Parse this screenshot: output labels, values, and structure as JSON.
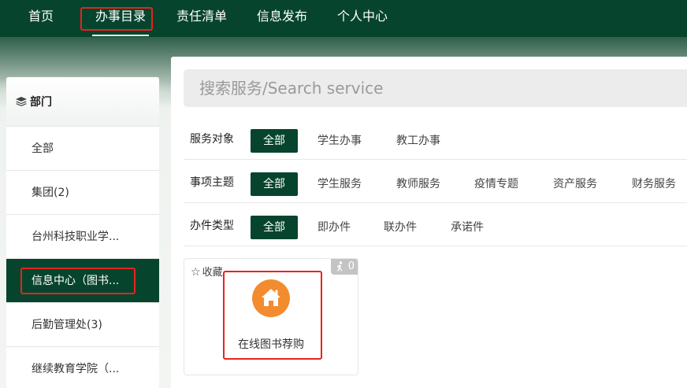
{
  "nav": {
    "items": [
      {
        "label": "首页"
      },
      {
        "label": "办事目录"
      },
      {
        "label": "责任清单"
      },
      {
        "label": "信息发布"
      },
      {
        "label": "个人中心"
      }
    ]
  },
  "sidebar": {
    "title": "部门",
    "items": [
      {
        "label": "全部"
      },
      {
        "label": "集团(2)"
      },
      {
        "label": "台州科技职业学..."
      },
      {
        "label": "信息中心（图书..."
      },
      {
        "label": "后勤管理处(3)"
      },
      {
        "label": "继续教育学院（..."
      }
    ]
  },
  "search": {
    "placeholder": "搜索服务/Search service"
  },
  "filters": {
    "target": {
      "label": "服务对象",
      "options": [
        "全部",
        "学生办事",
        "教工办事"
      ]
    },
    "topic": {
      "label": "事项主题",
      "options": [
        "全部",
        "学生服务",
        "教师服务",
        "疫情专题",
        "资产服务",
        "财务服务"
      ]
    },
    "type": {
      "label": "办件类型",
      "options": [
        "全部",
        "即办件",
        "联办件",
        "承诺件"
      ]
    }
  },
  "card": {
    "favorite_label": "收藏",
    "count": "0",
    "service_name": "在线图书荐购",
    "icon": "home-icon"
  },
  "colors": {
    "brand_green": "#07442e",
    "icon_orange": "#f38b2f",
    "highlight_red": "#e8231c"
  }
}
